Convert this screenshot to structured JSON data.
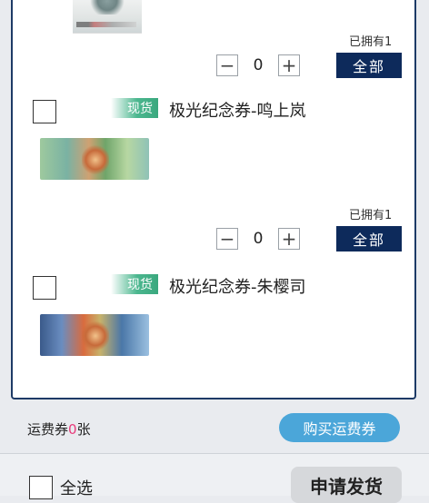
{
  "item_top": {
    "owned_label": "已拥有1",
    "quantity": "0",
    "all_label": "全部"
  },
  "items": [
    {
      "badge": "现货",
      "name": "极光纪念券-鸣上岚",
      "owned_label": "已拥有1",
      "quantity": "0",
      "all_label": "全部"
    },
    {
      "badge": "现货",
      "name": "极光纪念券-朱樱司"
    }
  ],
  "stepper": {
    "minus": "−",
    "plus": "+"
  },
  "shipping": {
    "prefix": "运费券",
    "count": "0",
    "suffix": "张",
    "buy_label": "购买运费券"
  },
  "footer": {
    "select_all_label": "全选",
    "apply_label": "申请发货"
  },
  "colors": {
    "accent_navy": "#0d2a5b",
    "badge_green": "#4cb78f",
    "buy_blue": "#4ba6d9",
    "count_pink": "#e83a7a"
  }
}
